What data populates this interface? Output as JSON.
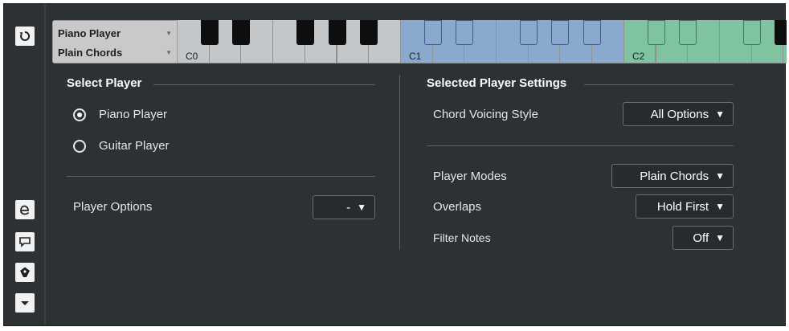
{
  "header": {
    "player_name": "Piano Player",
    "mode_name": "Plain Chords",
    "key_labels": [
      "C0",
      "C1",
      "C2"
    ]
  },
  "toolbar": {
    "icons": [
      "reset-icon",
      "editor-icon",
      "comment-icon",
      "tag-icon",
      "menu-down-icon"
    ]
  },
  "select_player": {
    "title": "Select Player",
    "options": [
      {
        "label": "Piano Player",
        "checked": true
      },
      {
        "label": "Guitar Player",
        "checked": false
      }
    ],
    "player_options_label": "Player Options",
    "player_options_value": "-"
  },
  "player_settings": {
    "title": "Selected Player Settings",
    "chord_voicing_label": "Chord Voicing Style",
    "chord_voicing_value": "All Options",
    "player_modes_label": "Player Modes",
    "player_modes_value": "Plain Chords",
    "overlaps_label": "Overlaps",
    "overlaps_value": "Hold First",
    "filter_notes_label": "Filter Notes",
    "filter_notes_value": "Off"
  },
  "colors": {
    "background": "#2c3133",
    "octave_0": "#c3c7c9",
    "octave_1": "#8aa9cf",
    "octave_2": "#7fc3a0"
  }
}
